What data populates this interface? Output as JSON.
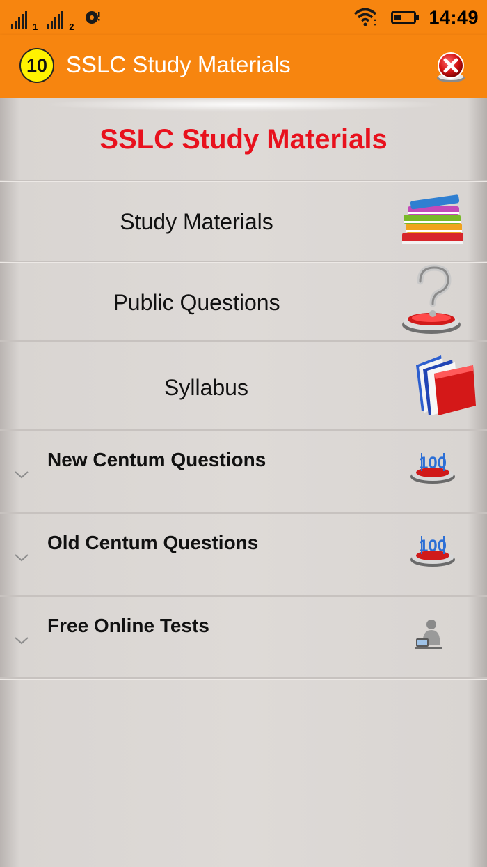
{
  "status_bar": {
    "sim1_label": "1",
    "sim2_label": "2",
    "time": "14:49",
    "battery_level": 0.35,
    "icons": [
      "signal-icon",
      "signal-icon",
      "sd-card-icon",
      "wifi-icon",
      "battery-icon"
    ]
  },
  "app_bar": {
    "logo_text": "10",
    "title": "SSLC Study Materials",
    "close_icon": "close-icon",
    "color": "#f7850f"
  },
  "main": {
    "heading": "SSLC Study Materials",
    "heading_color": "#e8111d",
    "menu_items": [
      {
        "label": "Study Materials",
        "icon": "books-icon"
      },
      {
        "label": "Public Questions",
        "icon": "question-mark-icon"
      },
      {
        "label": "Syllabus",
        "icon": "folders-icon"
      }
    ],
    "groups": [
      {
        "label": "New Centum Questions",
        "icon": "centum-100-icon",
        "expand_icon": "chevron-down-icon"
      },
      {
        "label": "Old Centum Questions",
        "icon": "centum-100-icon",
        "expand_icon": "chevron-down-icon"
      },
      {
        "label": "Free Online Tests",
        "icon": "online-test-person-icon",
        "expand_icon": "chevron-down-icon"
      }
    ]
  }
}
